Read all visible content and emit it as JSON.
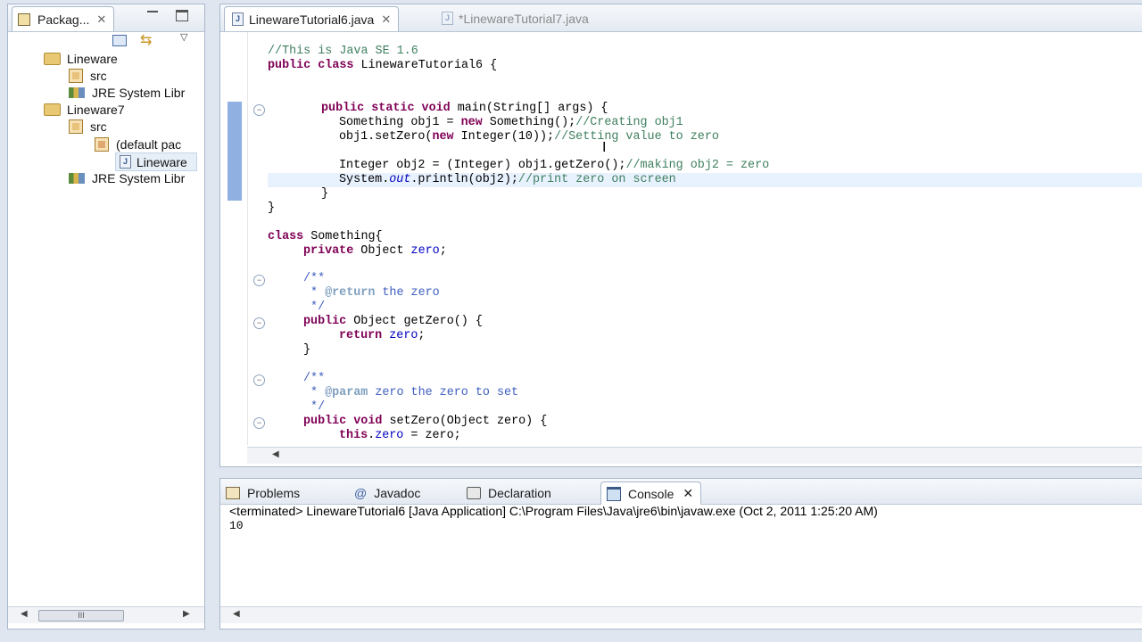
{
  "package_explorer": {
    "tab_label": "Packag...",
    "tree": [
      {
        "label": "Lineware",
        "icon": "project-icon"
      },
      {
        "label": "src",
        "icon": "source-folder-icon"
      },
      {
        "label": "JRE System Libr",
        "icon": "library-icon"
      },
      {
        "label": "Lineware7",
        "icon": "project-icon"
      },
      {
        "label": "src",
        "icon": "source-folder-icon"
      },
      {
        "label": "(default pac",
        "icon": "package-icon"
      },
      {
        "label": "Lineware",
        "icon": "java-file-icon"
      },
      {
        "label": "JRE System Libr",
        "icon": "library-icon"
      }
    ],
    "scroll_thumb": "III"
  },
  "editor": {
    "tabs": [
      {
        "label": "LinewareTutorial6.java",
        "active": true
      },
      {
        "label": "*LinewareTutorial7.java",
        "active": false
      }
    ],
    "code_lines": [
      "//This is Java SE 1.6",
      "public class LinewareTutorial6 {",
      "public static void main(String[] args) {",
      "Something obj1 = new Something();//Creating obj1",
      "obj1.setZero(new Integer(10));//Setting value to zero",
      "Integer obj2 = (Integer) obj1.getZero();//making obj2 = zero",
      "System.out.println(obj2);//print zero on screen",
      "}",
      "}",
      "class Something{",
      "private Object zero;",
      "/**",
      " * @return the zero",
      " */",
      "public Object getZero() {",
      "return zero;",
      "}",
      "/**",
      " * @param zero the zero to set",
      " */",
      "public void setZero(Object zero) {",
      "this.zero = zero;"
    ]
  },
  "bottom_panel": {
    "tabs": [
      {
        "label": "Problems",
        "icon": "problems-icon"
      },
      {
        "label": "Javadoc",
        "icon": "javadoc-icon"
      },
      {
        "label": "Declaration",
        "icon": "declaration-icon"
      },
      {
        "label": "Console",
        "icon": "console-icon",
        "active": true
      }
    ],
    "status_line": "<terminated> LinewareTutorial6 [Java Application] C:\\Program Files\\Java\\jre6\\bin\\javaw.exe (Oct 2, 2011 1:25:20 AM)",
    "output": "10"
  }
}
